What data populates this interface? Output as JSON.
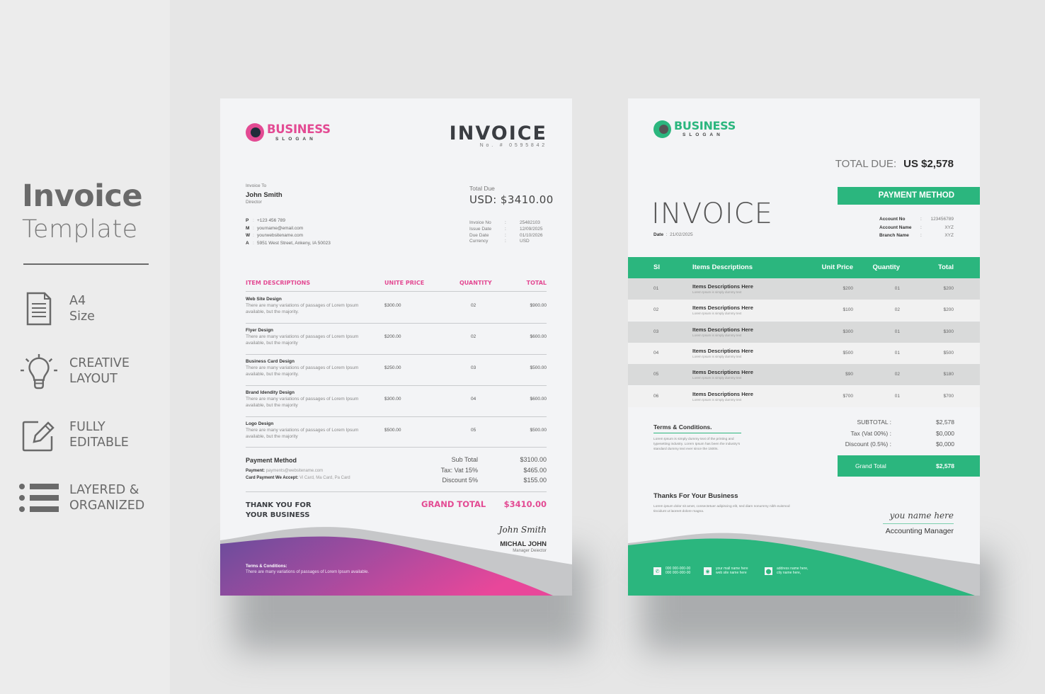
{
  "sidebar": {
    "title": "Invoice",
    "subtitle": "Template",
    "features": [
      {
        "icon": "document-icon",
        "line1": "A4",
        "line2": "Size"
      },
      {
        "icon": "lightbulb-icon",
        "line1": "CREATIVE",
        "line2": "LAYOUT"
      },
      {
        "icon": "edit-icon",
        "line1": "FULLY",
        "line2": "EDITABLE"
      },
      {
        "icon": "list-icon",
        "line1": "LAYERED &",
        "line2": "ORGANIZED"
      }
    ]
  },
  "pink_invoice": {
    "colors": {
      "accent": "#e34a93",
      "gradient_start": "#6a4c9c",
      "gradient_end": "#e8479a"
    },
    "logo": {
      "name": "BUSINESS",
      "slogan": "SLOGAN"
    },
    "title": "INVOICE",
    "number": "No. # 0595842",
    "invoice_to": {
      "label": "Invoice To",
      "name": "John Smith",
      "role": "Director"
    },
    "contacts": [
      {
        "key": "P",
        "value": "+123 456 789"
      },
      {
        "key": "M",
        "value": "yourname@email.com"
      },
      {
        "key": "W",
        "value": "yourwebsitename.com"
      },
      {
        "key": "A",
        "value": "5951 West Street, Ankeny, IA 50023"
      }
    ],
    "total_due": {
      "label": "Total Due",
      "value": "USD: $3410.00"
    },
    "meta": [
      {
        "key": "Invoice No",
        "value": "25482103"
      },
      {
        "key": "Issue Date",
        "value": "12/09/2025"
      },
      {
        "key": "Due Date",
        "value": "01/10/2026"
      },
      {
        "key": "Currency",
        "value": "USD"
      }
    ],
    "columns": [
      "ITEM DESCRIPTIONS",
      "UNITE PRICE",
      "QUANTITY",
      "TOTAL"
    ],
    "items": [
      {
        "name": "Web Site Design",
        "desc": "There are many variations of passages of Lorem Ipsum available, but the majority.",
        "price": "$300.00",
        "qty": "02",
        "total": "$900.00"
      },
      {
        "name": "Flyer Design",
        "desc": "There are many variations of passages of Lorem Ipsum available, but the majority",
        "price": "$200.00",
        "qty": "02",
        "total": "$600.00"
      },
      {
        "name": "Business Card Design",
        "desc": "There are many variations of passages of Lorem Ipsum available, but the majority.",
        "price": "$250.00",
        "qty": "03",
        "total": "$500.00"
      },
      {
        "name": "Brand Idendity Design",
        "desc": "There are many variations of passages of Lorem Ipsum available, but the majority",
        "price": "$300.00",
        "qty": "04",
        "total": "$600.00"
      },
      {
        "name": "Logo Design",
        "desc": "There are many variations of passages of Lorem Ipsum available, but the majority",
        "price": "$500.00",
        "qty": "05",
        "total": "$500.00"
      }
    ],
    "payment": {
      "title": "Payment Method",
      "payment_label": "Payment:",
      "payment_value": "payments@websitename.com",
      "card_label": "Card Payment We Accept:",
      "card_value": "Vi Card, Ma Card, Pa Card"
    },
    "summary": [
      {
        "key": "Sub Total",
        "value": "$3100.00"
      },
      {
        "key": "Tax: Vat 15%",
        "value": "$465.00"
      },
      {
        "key": "Discount 5%",
        "value": "$155.00"
      }
    ],
    "thanks_line1": "THANK YOU FOR",
    "thanks_line2": "YOUR BUSINESS",
    "grand_total": {
      "label": "GRAND TOTAL",
      "value": "$3410.00"
    },
    "signature": "John Smith",
    "signer": "MICHAL JOHN",
    "signer_role": "Manager Deiector",
    "terms": {
      "title": "Terms & Conditions:",
      "text": "There are many variations of passages of Lorem Ipsum available."
    }
  },
  "green_invoice": {
    "colors": {
      "accent": "#2bb67e"
    },
    "logo": {
      "name": "BUSINESS",
      "slogan": "SLOGAN"
    },
    "total_due_label": "TOTAL DUE:",
    "total_due_value": "US $2,578",
    "title": "INVOICE",
    "date_label": "Date",
    "date_value": "21/02/2025",
    "payment_method_label": "PAYMENT METHOD",
    "account": [
      {
        "key": "Account No",
        "value": "123456789"
      },
      {
        "key": "Account Name",
        "value": "XYZ"
      },
      {
        "key": "Branch Name",
        "value": "XYZ"
      }
    ],
    "columns": [
      "Sl",
      "Items Descriptions",
      "Unit Price",
      "Quantity",
      "Total"
    ],
    "items": [
      {
        "sl": "01",
        "name": "Items Descriptions Here",
        "desc": "Lorem Ipsum is simply dummy text",
        "price": "$200",
        "qty": "01",
        "total": "$200"
      },
      {
        "sl": "02",
        "name": "Items Descriptions Here",
        "desc": "Lorem Ipsum is simply dummy text",
        "price": "$100",
        "qty": "02",
        "total": "$200"
      },
      {
        "sl": "03",
        "name": "Items Descriptions Here",
        "desc": "Lorem Ipsum is simply dummy text",
        "price": "$300",
        "qty": "01",
        "total": "$300"
      },
      {
        "sl": "04",
        "name": "Items Descriptions Here",
        "desc": "Lorem Ipsum is simply dummy text",
        "price": "$500",
        "qty": "01",
        "total": "$500"
      },
      {
        "sl": "05",
        "name": "Items Descriptions Here",
        "desc": "Lorem Ipsum is simply dummy text",
        "price": "$90",
        "qty": "02",
        "total": "$180"
      },
      {
        "sl": "06",
        "name": "Items Descriptions Here",
        "desc": "Lorem Ipsum is simply dummy text",
        "price": "$700",
        "qty": "01",
        "total": "$700"
      }
    ],
    "terms": {
      "title": "Terms & Conditions.",
      "text": "Lorem Ipsum is simply dummy text of the printing and typesetting industry. Lorem Ipsum has been the industry's standard dummy text ever since the 1500s."
    },
    "summary": [
      {
        "key": "SUBTOTAL :",
        "value": "$2,578"
      },
      {
        "key": "Tax (Vat 00%) :",
        "value": "$0,000"
      },
      {
        "key": "Discount (0.5%) :",
        "value": "$0,000"
      }
    ],
    "grand_total": {
      "label": "Grand Total",
      "value": "$2,578"
    },
    "thanks": {
      "title": "Thanks For Your Business",
      "text": "Lorem ipsum dolor sit amet, consectetuer adipiscing elit, sed diam nonummy nibh euismod tincidunt ut laoreet dolore magna."
    },
    "signature": "you name here",
    "signer_role": "Accounting Manager",
    "contacts": [
      {
        "icon": "phone-icon",
        "line1": "000 000-000-00",
        "line2": "000 000-000-00"
      },
      {
        "icon": "globe-icon",
        "line1": "your mail name here",
        "line2": "web site name here"
      },
      {
        "icon": "location-pin-icon",
        "line1": "address name here,",
        "line2": "city name here,"
      }
    ]
  }
}
